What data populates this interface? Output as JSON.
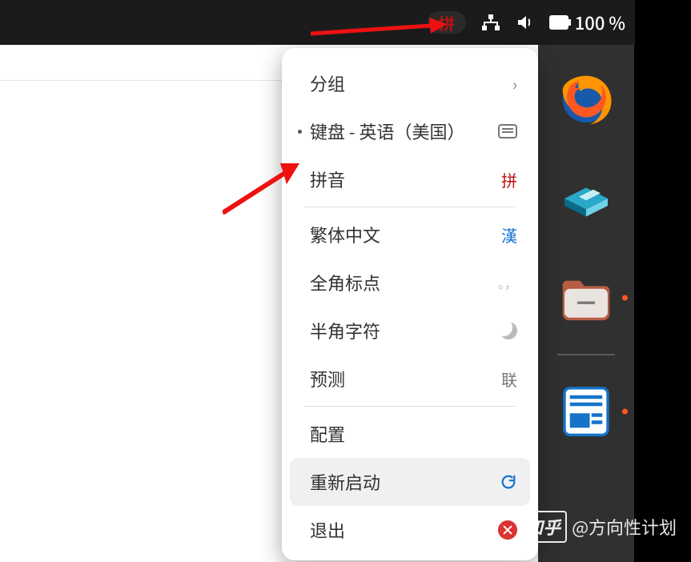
{
  "topbar": {
    "ime_badge": "拼",
    "battery_text": "100 %"
  },
  "menu": {
    "group": {
      "label": "分组"
    },
    "kb_en": {
      "label": "键盘 - 英语（美国）"
    },
    "pinyin": {
      "label": "拼音",
      "badge": "拼"
    },
    "traditional": {
      "label": "繁体中文",
      "badge": "漢"
    },
    "fullwidth_punct": {
      "label": "全角标点",
      "badge": "。，"
    },
    "halfwidth_char": {
      "label": "半角字符"
    },
    "predict": {
      "label": "预测",
      "badge": "联"
    },
    "config": {
      "label": "配置"
    },
    "restart": {
      "label": "重新启动"
    },
    "quit": {
      "label": "退出"
    }
  },
  "watermark": {
    "logo": "知乎",
    "handle": "@方向性计划"
  }
}
